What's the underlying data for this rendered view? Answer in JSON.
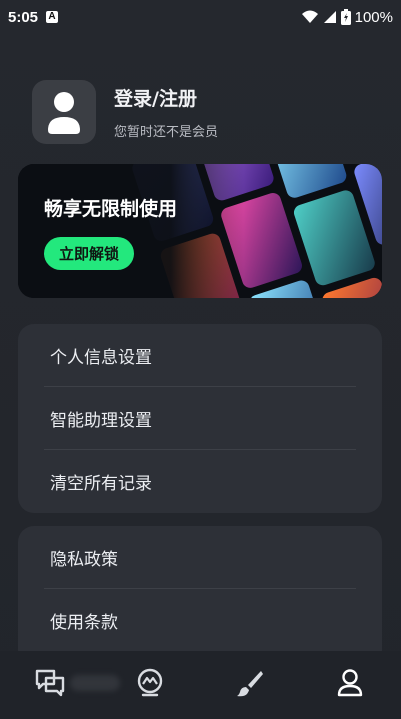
{
  "status_bar": {
    "time": "5:05",
    "notification_icon": "a-icon",
    "battery": "100%"
  },
  "profile": {
    "title": "登录/注册",
    "subtitle": "您暂时还不是会员"
  },
  "banner": {
    "title": "畅享无限制使用",
    "button_label": "立即解锁"
  },
  "menu_group_1": {
    "items": [
      {
        "label": "个人信息设置"
      },
      {
        "label": "智能助理设置"
      },
      {
        "label": "清空所有记录"
      }
    ]
  },
  "menu_group_2": {
    "items": [
      {
        "label": "隐私政策"
      },
      {
        "label": "使用条款"
      }
    ]
  },
  "bottom_nav": {
    "items": [
      {
        "icon": "chat-icon"
      },
      {
        "icon": "ai-avatar-icon"
      },
      {
        "icon": "brush-icon"
      },
      {
        "icon": "user-icon"
      }
    ]
  },
  "colors": {
    "background": "#24272d",
    "card": "#2d3037",
    "accent_green": "#23e87d",
    "nav_background": "#202329"
  }
}
